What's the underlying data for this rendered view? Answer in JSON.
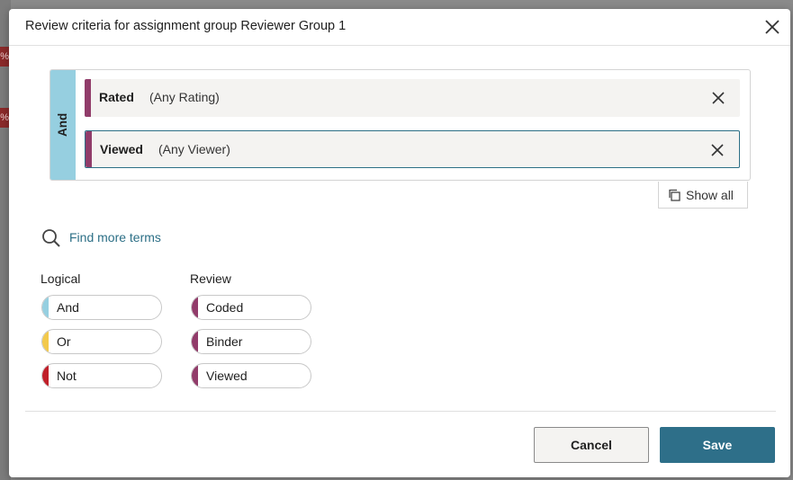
{
  "background": {
    "badges": [
      "%",
      "%"
    ]
  },
  "dialog": {
    "title": "Review criteria for assignment group Reviewer Group 1",
    "criteria": {
      "operator_label": "And",
      "terms": [
        {
          "name": "Rated",
          "detail": "(Any Rating)"
        },
        {
          "name": "Viewed",
          "detail": "(Any Viewer)"
        }
      ],
      "show_all_label": "Show all"
    },
    "find_more_label": "Find more terms",
    "groups": {
      "logical": {
        "title": "Logical",
        "items": [
          "And",
          "Or",
          "Not"
        ]
      },
      "review": {
        "title": "Review",
        "items": [
          "Coded",
          "Binder",
          "Viewed"
        ]
      }
    },
    "footer": {
      "cancel_label": "Cancel",
      "save_label": "Save"
    }
  },
  "colors": {
    "and": "#96cfe0",
    "or": "#f2c94c",
    "not": "#c0202a",
    "review": "#913c6a",
    "primary": "#2e6f89",
    "link": "#2c6f86"
  }
}
